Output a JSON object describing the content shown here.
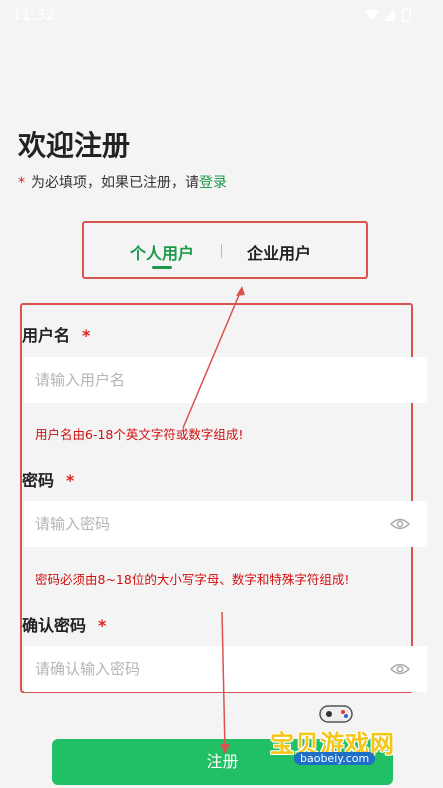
{
  "status_bar": {
    "time": "11:32",
    "icons": [
      "wifi-icon",
      "signal-icon",
      "battery-icon"
    ]
  },
  "header": {
    "title": "欢迎注册",
    "required_star": "*",
    "subtitle_text": "为必填项，如果已注册，请",
    "login_link": "登录"
  },
  "tabs": {
    "personal": "个人用户",
    "divider": "|",
    "enterprise": "企业用户"
  },
  "form": {
    "username": {
      "label": "用户名",
      "star": "*",
      "placeholder": "请输入用户名",
      "hint": "用户名由6-18个英文字符或数字组成!"
    },
    "password": {
      "label": "密码",
      "star": "*",
      "placeholder": "请输入密码",
      "hint": "密码必须由8~18位的大小写字母、数字和特殊字符组成!"
    },
    "confirm_password": {
      "label": "确认密码",
      "star": "*",
      "placeholder": "请确认输入密码"
    }
  },
  "register_button": "注册",
  "watermark": {
    "text": "宝贝游戏网",
    "url": "baobeiy.com"
  },
  "colors": {
    "accent": "#1a9a4a",
    "button": "#22c065",
    "error": "#d01010",
    "annotation": "#d9534f"
  }
}
